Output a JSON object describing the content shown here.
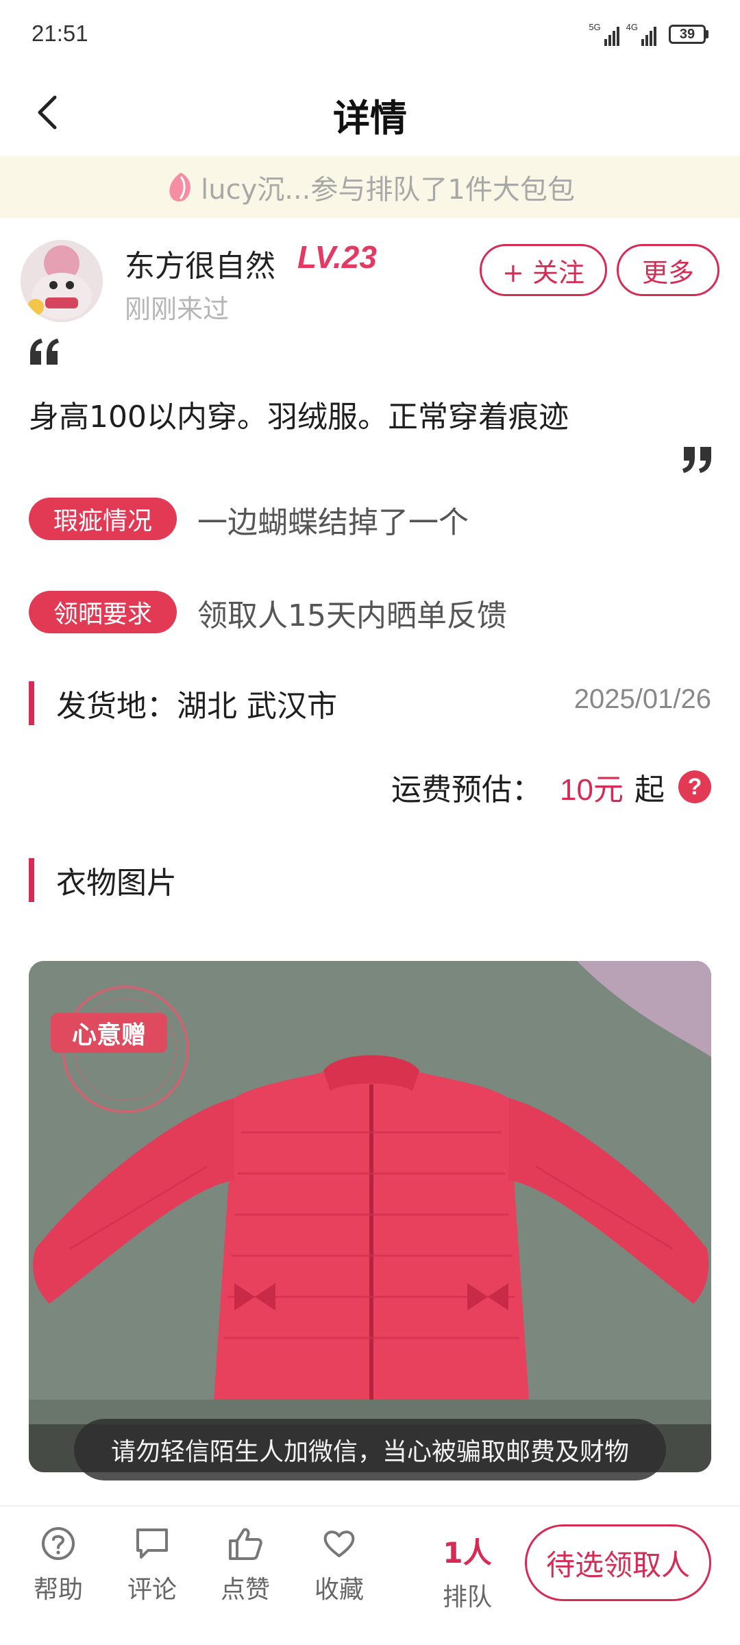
{
  "status_bar": {
    "time": "21:51",
    "net1": "5G",
    "net2": "4G",
    "battery": "39"
  },
  "nav": {
    "title": "详情"
  },
  "notice": {
    "text": "lucy沉...参与排队了1件大包包"
  },
  "user": {
    "name": "东方很自然",
    "level": "LV.23",
    "last_seen": "刚刚来过",
    "follow_label": "+ 关注",
    "more_label": "更多"
  },
  "item": {
    "description": "身高100以内穿。羽绒服。正常穿着痕迹",
    "defect_tag": "瑕疵情况",
    "defect_value": "一边蝴蝶结掉了一个",
    "requirement_tag": "领晒要求",
    "requirement_value": "领取人15天内晒单反馈",
    "location": "发货地：湖北 武汉市",
    "date": "2025/01/26",
    "shipping_label": "运费预估：",
    "shipping_price": "10元",
    "shipping_suffix": "起",
    "help_symbol": "?"
  },
  "photos": {
    "section_title": "衣物图片",
    "stamp_text": "心意赠",
    "warning": "请勿轻信陌生人加微信，当心被骗取邮费及财物"
  },
  "bottom_bar": {
    "help": "帮助",
    "comment": "评论",
    "like": "点赞",
    "favorite": "收藏",
    "queue_count": "1人",
    "queue_label": "排队",
    "claim": "待选领取人"
  },
  "colors": {
    "accent": "#d52c55",
    "notice_bg": "#fbf7e6",
    "tag_bg": "#e23a55"
  }
}
